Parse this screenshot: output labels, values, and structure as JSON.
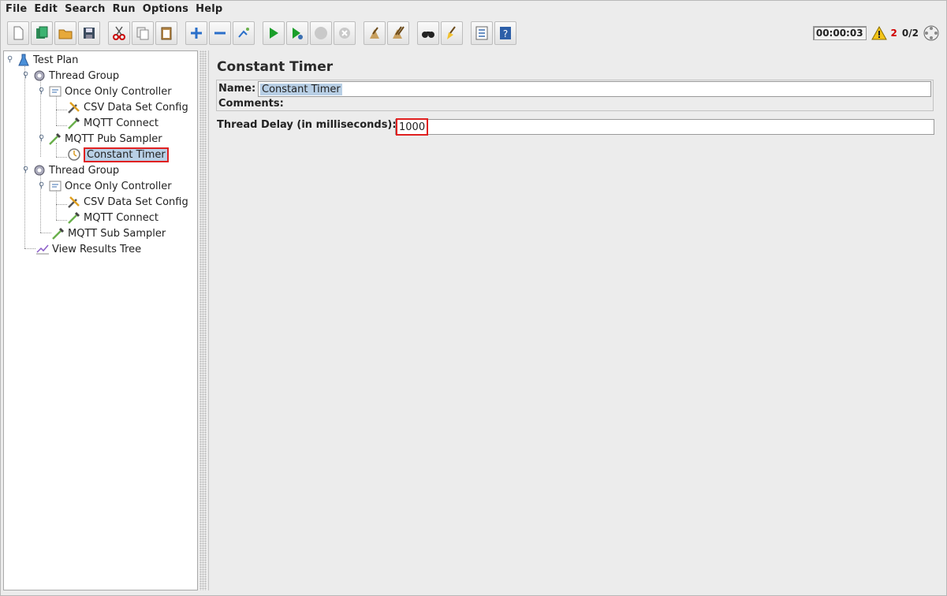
{
  "menu": [
    "File",
    "Edit",
    "Search",
    "Run",
    "Options",
    "Help"
  ],
  "toolbar": {
    "buttons": [
      "new-icon",
      "templates-icon",
      "open-icon",
      "save-icon",
      "cut-icon",
      "copy-icon",
      "paste-icon",
      "expand-icon",
      "collapse-icon",
      "toggle-icon",
      "start-icon",
      "start-no-pauses-icon",
      "stop-icon",
      "shutdown-icon",
      "clear-icon",
      "clear-all-icon",
      "search-icon",
      "reset-search-icon",
      "function-helper-icon",
      "help-icon"
    ],
    "elapsed": "00:00:03",
    "warnings": "2",
    "threads": "0/2"
  },
  "tree": {
    "nodes": [
      {
        "label": "Test Plan",
        "icon": "flask-icon",
        "level": 0
      },
      {
        "label": "Thread Group",
        "icon": "gear-icon",
        "level": 1
      },
      {
        "label": "Once Only Controller",
        "icon": "controller-icon",
        "level": 2
      },
      {
        "label": "CSV Data Set Config",
        "icon": "wrench-icon",
        "level": 3
      },
      {
        "label": "MQTT Connect",
        "icon": "pipette-icon",
        "level": 3
      },
      {
        "label": "MQTT Pub Sampler",
        "icon": "pipette-icon",
        "level": 2
      },
      {
        "label": "Constant Timer",
        "icon": "timer-icon",
        "level": 3,
        "selected": true
      },
      {
        "label": "Thread Group",
        "icon": "gear-icon",
        "level": 1
      },
      {
        "label": "Once Only Controller",
        "icon": "controller-icon",
        "level": 2
      },
      {
        "label": "CSV Data Set Config",
        "icon": "wrench-icon",
        "level": 3
      },
      {
        "label": "MQTT Connect",
        "icon": "pipette-icon",
        "level": 3
      },
      {
        "label": "MQTT Sub Sampler",
        "icon": "pipette-icon",
        "level": 2
      },
      {
        "label": "View Results Tree",
        "icon": "graph-icon",
        "level": 1
      }
    ]
  },
  "panel": {
    "title": "Constant Timer",
    "name_label": "Name:",
    "name_value": "Constant Timer",
    "comments_label": "Comments:",
    "delay_label": "Thread Delay (in milliseconds):",
    "delay_value": "1000"
  }
}
